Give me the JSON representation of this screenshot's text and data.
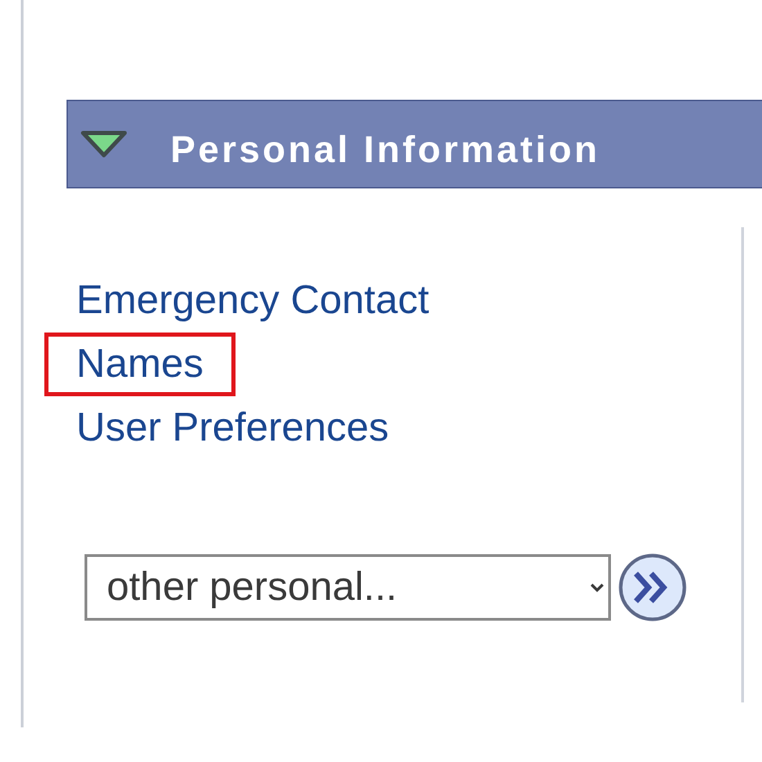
{
  "panel": {
    "title": "Personal Information",
    "expanded": true
  },
  "links": [
    {
      "label": "Emergency Contact",
      "highlighted": false
    },
    {
      "label": "Names",
      "highlighted": true
    },
    {
      "label": "User Preferences",
      "highlighted": false
    }
  ],
  "dropdown": {
    "value": "other personal..."
  }
}
